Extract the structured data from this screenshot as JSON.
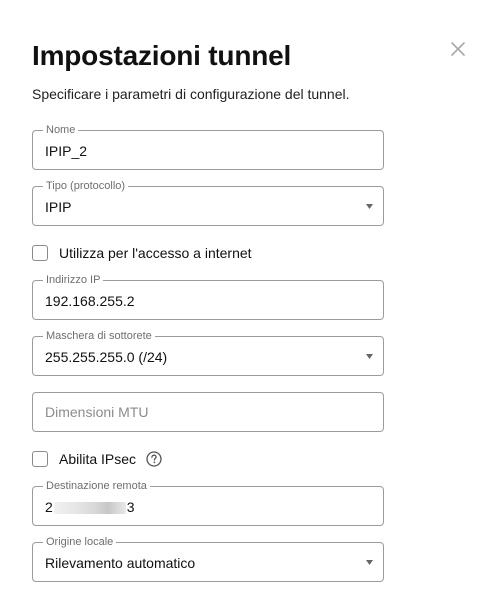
{
  "header": {
    "title": "Impostazioni tunnel",
    "subtitle": "Specificare i parametri di configurazione del tunnel.",
    "close_icon": "close-icon"
  },
  "fields": {
    "name": {
      "label": "Nome",
      "value": "IPIP_2"
    },
    "type": {
      "label": "Tipo (protocollo)",
      "value": "IPIP"
    },
    "internet_access": {
      "label": "Utilizza per l'accesso a internet",
      "checked": false
    },
    "ip_address": {
      "label": "Indirizzo IP",
      "value": "192.168.255.2"
    },
    "subnet_mask": {
      "label": "Maschera di sottorete",
      "value": "255.255.255.0 (/24)"
    },
    "mtu": {
      "placeholder": "Dimensioni MTU",
      "value": ""
    },
    "ipsec": {
      "label": "Abilita IPsec",
      "checked": false,
      "help_icon": "help-icon"
    },
    "remote_destination": {
      "label": "Destinazione remota",
      "value_start": "2",
      "value_end": "3"
    },
    "local_origin": {
      "label": "Origine locale",
      "value": "Rilevamento automatico"
    }
  },
  "colors": {
    "border": "#9b9b9b",
    "label": "#6e6e6e",
    "text": "#111111",
    "placeholder": "#8c8c8c"
  }
}
